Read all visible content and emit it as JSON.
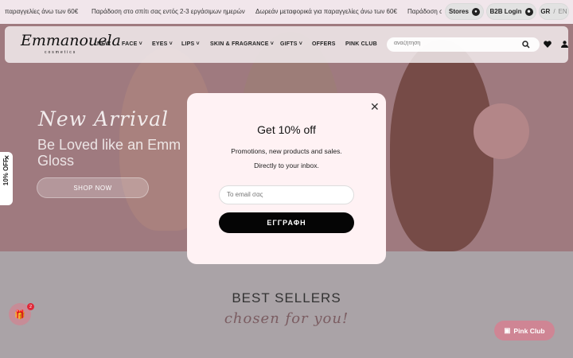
{
  "announcements": [
    "παραγγελίες άνω των 60€",
    "Παράδοση στο σπίτι σας εντός 2-3 εργάσιμων ημερών",
    "Δωρεάν μεταφορικά για παραγγελίες άνω των 60€",
    "Παράδοση στ"
  ],
  "header": {
    "stores_label": "Stores",
    "b2b_label": "B2B Login",
    "lang_gr": "GR",
    "lang_sep": "/",
    "lang_en": "EN",
    "logo_text": "Emmanouela",
    "logo_sub": "cosmetics",
    "nav": [
      "NEW",
      "FACE",
      "EYES",
      "LIPS",
      "SKIN & FRAGRANCE",
      "GIFTS",
      "OFFERS",
      "PINK CLUB"
    ],
    "search_placeholder": "αναζήτηση"
  },
  "hero": {
    "script_title": "New Arrival",
    "headline": "Be Loved like an Emm Gloss",
    "cta": "SHOP NOW"
  },
  "side_tab": "10% OFF",
  "modal": {
    "title": "Get 10% off",
    "line1": "Promotions, new products and sales.",
    "line2": "Directly to your inbox.",
    "email_placeholder": "Το email σας",
    "submit_label": "ΕΓΓΡΑΦΗ"
  },
  "section": {
    "title": "BEST SELLERS",
    "subtitle": "chosen for you!"
  },
  "gift_badge_count": "2",
  "pink_club_button": "Pink Club"
}
